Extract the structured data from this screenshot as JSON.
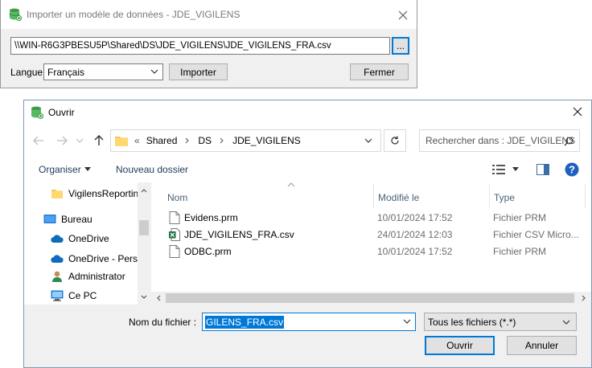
{
  "importer": {
    "title": "Importer un modèle de données - JDE_VIGILENS",
    "path_value": "\\\\WIN-R6G3PBESU5P\\Shared\\DS\\JDE_VIGILENS\\JDE_VIGILENS_FRA.csv",
    "browse_label": "...",
    "language_label": "Langue",
    "language_value": "Français",
    "import_button": "Importer",
    "close_button": "Fermer"
  },
  "open_dialog": {
    "title": "Ouvrir",
    "breadcrumb": {
      "overflow": "«",
      "items": [
        "Shared",
        "DS",
        "JDE_VIGILENS"
      ]
    },
    "search_placeholder": "Rechercher dans : JDE_VIGILENS",
    "organize_label": "Organiser",
    "new_folder_label": "Nouveau dossier",
    "nav_items": [
      {
        "label": "VigilensReportin",
        "icon": "folder-icon"
      },
      {
        "label": "Bureau",
        "icon": "desktop-icon"
      },
      {
        "label": "OneDrive",
        "icon": "cloud-icon"
      },
      {
        "label": "OneDrive - Perso",
        "icon": "cloud-icon"
      },
      {
        "label": "Administrator",
        "icon": "user-icon"
      },
      {
        "label": "Ce PC",
        "icon": "computer-icon"
      }
    ],
    "columns": {
      "name": "Nom",
      "modified": "Modifié le",
      "type": "Type"
    },
    "files": [
      {
        "name": "Evidens.prm",
        "modified": "10/01/2024 17:52",
        "type": "Fichier PRM",
        "icon": "document-icon"
      },
      {
        "name": "JDE_VIGILENS_FRA.csv",
        "modified": "24/01/2024 12:03",
        "type": "Fichier CSV Micro...",
        "icon": "excel-icon"
      },
      {
        "name": "ODBC.prm",
        "modified": "10/01/2024 17:52",
        "type": "Fichier PRM",
        "icon": "document-icon"
      }
    ],
    "filename_label": "Nom du fichier :",
    "filename_value": "GILENS_FRA.csv",
    "filter_value": "Tous les fichiers (*.*)",
    "open_button": "Ouvrir",
    "cancel_button": "Annuler"
  },
  "colors": {
    "accent": "#0078d7",
    "help": "#1f5fbf",
    "excel": "#1d6f42",
    "db_icon": "#3d9c4a"
  }
}
